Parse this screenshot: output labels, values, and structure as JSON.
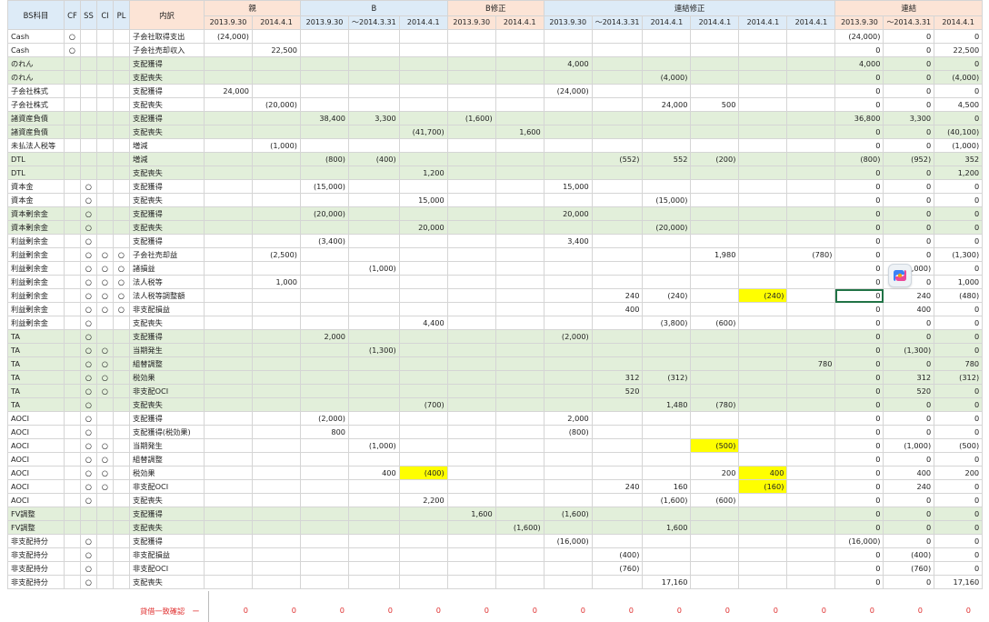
{
  "header": {
    "top": {
      "bs": "BS科目",
      "cf": "CF",
      "ss": "SS",
      "ci": "CI",
      "pl": "PL",
      "desc": "内訳",
      "g1": "親",
      "g2": "B",
      "g3": "B修正",
      "g4": "連結修正",
      "g5": "連結"
    },
    "sub": [
      "2013.9.30",
      "2014.4.1",
      "2013.9.30",
      "～2014.3.31",
      "2014.4.1",
      "2013.9.30",
      "2014.4.1",
      "2013.9.30",
      "～2014.3.31",
      "2014.4.1",
      "2014.4.1",
      "2014.4.1",
      "2014.4.1",
      "2013.9.30",
      "～2014.3.31",
      "2014.4.1"
    ]
  },
  "rows": [
    {
      "bs": "Cash",
      "cf": "○",
      "ss": "",
      "ci": "",
      "pl": "",
      "desc": "子会社取得支出",
      "v": [
        "(24,000)",
        "",
        "",
        "",
        "",
        "",
        "",
        "",
        "",
        "",
        "",
        "",
        "",
        "(24,000)",
        "0",
        "0"
      ]
    },
    {
      "bs": "Cash",
      "cf": "○",
      "ss": "",
      "ci": "",
      "pl": "",
      "desc": "子会社売却収入",
      "v": [
        "",
        "22,500",
        "",
        "",
        "",
        "",
        "",
        "",
        "",
        "",
        "",
        "",
        "",
        "0",
        "0",
        "22,500"
      ]
    },
    {
      "bs": "のれん",
      "cf": "",
      "ss": "",
      "ci": "",
      "pl": "",
      "desc": "支配獲得",
      "v": [
        "",
        "",
        "",
        "",
        "",
        "",
        "",
        "4,000",
        "",
        "",
        "",
        "",
        "",
        "4,000",
        "0",
        "0"
      ]
    },
    {
      "bs": "のれん",
      "cf": "",
      "ss": "",
      "ci": "",
      "pl": "",
      "desc": "支配喪失",
      "v": [
        "",
        "",
        "",
        "",
        "",
        "",
        "",
        "",
        "",
        "(4,000)",
        "",
        "",
        "",
        "0",
        "0",
        "(4,000)"
      ]
    },
    {
      "bs": "子会社株式",
      "cf": "",
      "ss": "",
      "ci": "",
      "pl": "",
      "desc": "支配獲得",
      "v": [
        "24,000",
        "",
        "",
        "",
        "",
        "",
        "",
        "(24,000)",
        "",
        "",
        "",
        "",
        "",
        "0",
        "0",
        "0"
      ]
    },
    {
      "bs": "子会社株式",
      "cf": "",
      "ss": "",
      "ci": "",
      "pl": "",
      "desc": "支配喪失",
      "v": [
        "",
        "(20,000)",
        "",
        "",
        "",
        "",
        "",
        "",
        "",
        "24,000",
        "500",
        "",
        "",
        "0",
        "0",
        "4,500"
      ]
    },
    {
      "bs": "諸資産負債",
      "cf": "",
      "ss": "",
      "ci": "",
      "pl": "",
      "desc": "支配獲得",
      "v": [
        "",
        "",
        "38,400",
        "3,300",
        "",
        "(1,600)",
        "",
        "",
        "",
        "",
        "",
        "",
        "",
        "36,800",
        "3,300",
        "0"
      ]
    },
    {
      "bs": "諸資産負債",
      "cf": "",
      "ss": "",
      "ci": "",
      "pl": "",
      "desc": "支配喪失",
      "v": [
        "",
        "",
        "",
        "",
        "(41,700)",
        "",
        "1,600",
        "",
        "",
        "",
        "",
        "",
        "",
        "0",
        "0",
        "(40,100)"
      ]
    },
    {
      "bs": "未払法人税等",
      "cf": "",
      "ss": "",
      "ci": "",
      "pl": "",
      "desc": "増減",
      "v": [
        "",
        "(1,000)",
        "",
        "",
        "",
        "",
        "",
        "",
        "",
        "",
        "",
        "",
        "",
        "0",
        "0",
        "(1,000)"
      ]
    },
    {
      "bs": "DTL",
      "cf": "",
      "ss": "",
      "ci": "",
      "pl": "",
      "desc": "増減",
      "v": [
        "",
        "",
        "(800)",
        "(400)",
        "",
        "",
        "",
        "",
        "(552)",
        "552",
        "(200)",
        "",
        "",
        "(800)",
        "(952)",
        "352"
      ]
    },
    {
      "bs": "DTL",
      "cf": "",
      "ss": "",
      "ci": "",
      "pl": "",
      "desc": "支配喪失",
      "v": [
        "",
        "",
        "",
        "",
        "1,200",
        "",
        "",
        "",
        "",
        "",
        "",
        "",
        "",
        "0",
        "0",
        "1,200"
      ]
    },
    {
      "bs": "資本金",
      "cf": "",
      "ss": "○",
      "ci": "",
      "pl": "",
      "desc": "支配獲得",
      "v": [
        "",
        "",
        "(15,000)",
        "",
        "",
        "",
        "",
        "15,000",
        "",
        "",
        "",
        "",
        "",
        "0",
        "0",
        "0"
      ]
    },
    {
      "bs": "資本金",
      "cf": "",
      "ss": "○",
      "ci": "",
      "pl": "",
      "desc": "支配喪失",
      "v": [
        "",
        "",
        "",
        "",
        "15,000",
        "",
        "",
        "",
        "",
        "(15,000)",
        "",
        "",
        "",
        "0",
        "0",
        "0"
      ]
    },
    {
      "bs": "資本剰余金",
      "cf": "",
      "ss": "○",
      "ci": "",
      "pl": "",
      "desc": "支配獲得",
      "v": [
        "",
        "",
        "(20,000)",
        "",
        "",
        "",
        "",
        "20,000",
        "",
        "",
        "",
        "",
        "",
        "0",
        "0",
        "0"
      ]
    },
    {
      "bs": "資本剰余金",
      "cf": "",
      "ss": "○",
      "ci": "",
      "pl": "",
      "desc": "支配喪失",
      "v": [
        "",
        "",
        "",
        "",
        "20,000",
        "",
        "",
        "",
        "",
        "(20,000)",
        "",
        "",
        "",
        "0",
        "0",
        "0"
      ]
    },
    {
      "bs": "利益剰余金",
      "cf": "",
      "ss": "○",
      "ci": "",
      "pl": "",
      "desc": "支配獲得",
      "v": [
        "",
        "",
        "(3,400)",
        "",
        "",
        "",
        "",
        "3,400",
        "",
        "",
        "",
        "",
        "",
        "0",
        "0",
        "0"
      ]
    },
    {
      "bs": "利益剰余金",
      "cf": "",
      "ss": "○",
      "ci": "○",
      "pl": "○",
      "desc": "子会社売却益",
      "v": [
        "",
        "(2,500)",
        "",
        "",
        "",
        "",
        "",
        "",
        "",
        "",
        "1,980",
        "",
        "(780)",
        "0",
        "0",
        "(1,300)"
      ]
    },
    {
      "bs": "利益剰余金",
      "cf": "",
      "ss": "○",
      "ci": "○",
      "pl": "○",
      "desc": "諸損益",
      "v": [
        "",
        "",
        "",
        "(1,000)",
        "",
        "",
        "",
        "",
        "",
        "",
        "",
        "",
        "",
        "0",
        "(1,000)",
        "0"
      ]
    },
    {
      "bs": "利益剰余金",
      "cf": "",
      "ss": "○",
      "ci": "○",
      "pl": "○",
      "desc": "法人税等",
      "v": [
        "",
        "1,000",
        "",
        "",
        "",
        "",
        "",
        "",
        "",
        "",
        "",
        "",
        "",
        "0",
        "0",
        "1,000"
      ]
    },
    {
      "bs": "利益剰余金",
      "cf": "",
      "ss": "○",
      "ci": "○",
      "pl": "○",
      "desc": "法人税等調整額",
      "v": [
        "",
        "",
        "",
        "",
        "",
        "",
        "",
        "",
        "240",
        "(240)",
        "",
        "(240)",
        "",
        "0",
        "240",
        "(480)"
      ]
    },
    {
      "bs": "利益剰余金",
      "cf": "",
      "ss": "○",
      "ci": "○",
      "pl": "○",
      "desc": "非支配損益",
      "v": [
        "",
        "",
        "",
        "",
        "",
        "",
        "",
        "",
        "400",
        "",
        "",
        "",
        "",
        "0",
        "400",
        "0"
      ]
    },
    {
      "bs": "利益剰余金",
      "cf": "",
      "ss": "○",
      "ci": "",
      "pl": "",
      "desc": "支配喪失",
      "v": [
        "",
        "",
        "",
        "",
        "4,400",
        "",
        "",
        "",
        "",
        "(3,800)",
        "(600)",
        "",
        "",
        "0",
        "0",
        "0"
      ]
    },
    {
      "bs": "TA",
      "cf": "",
      "ss": "○",
      "ci": "",
      "pl": "",
      "desc": "支配獲得",
      "v": [
        "",
        "",
        "2,000",
        "",
        "",
        "",
        "",
        "(2,000)",
        "",
        "",
        "",
        "",
        "",
        "0",
        "0",
        "0"
      ]
    },
    {
      "bs": "TA",
      "cf": "",
      "ss": "○",
      "ci": "○",
      "pl": "",
      "desc": "当期発生",
      "v": [
        "",
        "",
        "",
        "(1,300)",
        "",
        "",
        "",
        "",
        "",
        "",
        "",
        "",
        "",
        "0",
        "(1,300)",
        "0"
      ]
    },
    {
      "bs": "TA",
      "cf": "",
      "ss": "○",
      "ci": "○",
      "pl": "",
      "desc": "組替調整",
      "v": [
        "",
        "",
        "",
        "",
        "",
        "",
        "",
        "",
        "",
        "",
        "",
        "",
        "780",
        "0",
        "0",
        "780"
      ]
    },
    {
      "bs": "TA",
      "cf": "",
      "ss": "○",
      "ci": "○",
      "pl": "",
      "desc": "税効果",
      "v": [
        "",
        "",
        "",
        "",
        "",
        "",
        "",
        "",
        "312",
        "(312)",
        "",
        "",
        "",
        "0",
        "312",
        "(312)"
      ]
    },
    {
      "bs": "TA",
      "cf": "",
      "ss": "○",
      "ci": "○",
      "pl": "",
      "desc": "非支配OCI",
      "v": [
        "",
        "",
        "",
        "",
        "",
        "",
        "",
        "",
        "520",
        "",
        "",
        "",
        "",
        "0",
        "520",
        "0"
      ]
    },
    {
      "bs": "TA",
      "cf": "",
      "ss": "○",
      "ci": "",
      "pl": "",
      "desc": "支配喪失",
      "v": [
        "",
        "",
        "",
        "",
        "(700)",
        "",
        "",
        "",
        "",
        "1,480",
        "(780)",
        "",
        "",
        "0",
        "0",
        "0"
      ]
    },
    {
      "bs": "AOCI",
      "cf": "",
      "ss": "○",
      "ci": "",
      "pl": "",
      "desc": "支配獲得",
      "v": [
        "",
        "",
        "(2,000)",
        "",
        "",
        "",
        "",
        "2,000",
        "",
        "",
        "",
        "",
        "",
        "0",
        "0",
        "0"
      ]
    },
    {
      "bs": "AOCI",
      "cf": "",
      "ss": "○",
      "ci": "",
      "pl": "",
      "desc": "支配獲得(税効果)",
      "v": [
        "",
        "",
        "800",
        "",
        "",
        "",
        "",
        "(800)",
        "",
        "",
        "",
        "",
        "",
        "0",
        "0",
        "0"
      ]
    },
    {
      "bs": "AOCI",
      "cf": "",
      "ss": "○",
      "ci": "○",
      "pl": "",
      "desc": "当期発生",
      "v": [
        "",
        "",
        "",
        "(1,000)",
        "",
        "",
        "",
        "",
        "",
        "",
        "(500)",
        "",
        "",
        "0",
        "(1,000)",
        "(500)"
      ]
    },
    {
      "bs": "AOCI",
      "cf": "",
      "ss": "○",
      "ci": "○",
      "pl": "",
      "desc": "組替調整",
      "v": [
        "",
        "",
        "",
        "",
        "",
        "",
        "",
        "",
        "",
        "",
        "",
        "",
        "",
        "0",
        "0",
        "0"
      ]
    },
    {
      "bs": "AOCI",
      "cf": "",
      "ss": "○",
      "ci": "○",
      "pl": "",
      "desc": "税効果",
      "v": [
        "",
        "",
        "",
        "400",
        "(400)",
        "",
        "",
        "",
        "",
        "",
        "200",
        "400",
        "",
        "0",
        "400",
        "200"
      ]
    },
    {
      "bs": "AOCI",
      "cf": "",
      "ss": "○",
      "ci": "○",
      "pl": "",
      "desc": "非支配OCI",
      "v": [
        "",
        "",
        "",
        "",
        "",
        "",
        "",
        "",
        "240",
        "160",
        "",
        "(160)",
        "",
        "0",
        "240",
        "0"
      ]
    },
    {
      "bs": "AOCI",
      "cf": "",
      "ss": "○",
      "ci": "",
      "pl": "",
      "desc": "支配喪失",
      "v": [
        "",
        "",
        "",
        "",
        "2,200",
        "",
        "",
        "",
        "",
        "(1,600)",
        "(600)",
        "",
        "",
        "0",
        "0",
        "0"
      ]
    },
    {
      "bs": "FV調整",
      "cf": "",
      "ss": "",
      "ci": "",
      "pl": "",
      "desc": "支配獲得",
      "v": [
        "",
        "",
        "",
        "",
        "",
        "1,600",
        "",
        "(1,600)",
        "",
        "",
        "",
        "",
        "",
        "0",
        "0",
        "0"
      ]
    },
    {
      "bs": "FV調整",
      "cf": "",
      "ss": "",
      "ci": "",
      "pl": "",
      "desc": "支配喪失",
      "v": [
        "",
        "",
        "",
        "",
        "",
        "",
        "(1,600)",
        "",
        "",
        "1,600",
        "",
        "",
        "",
        "0",
        "0",
        "0"
      ]
    },
    {
      "bs": "非支配持分",
      "cf": "",
      "ss": "○",
      "ci": "",
      "pl": "",
      "desc": "支配獲得",
      "v": [
        "",
        "",
        "",
        "",
        "",
        "",
        "",
        "(16,000)",
        "",
        "",
        "",
        "",
        "",
        "(16,000)",
        "0",
        "0"
      ]
    },
    {
      "bs": "非支配持分",
      "cf": "",
      "ss": "○",
      "ci": "",
      "pl": "",
      "desc": "非支配損益",
      "v": [
        "",
        "",
        "",
        "",
        "",
        "",
        "",
        "",
        "(400)",
        "",
        "",
        "",
        "",
        "0",
        "(400)",
        "0"
      ]
    },
    {
      "bs": "非支配持分",
      "cf": "",
      "ss": "○",
      "ci": "",
      "pl": "",
      "desc": "非支配OCI",
      "v": [
        "",
        "",
        "",
        "",
        "",
        "",
        "",
        "",
        "(760)",
        "",
        "",
        "",
        "",
        "0",
        "(760)",
        "0"
      ]
    },
    {
      "bs": "非支配持分",
      "cf": "",
      "ss": "○",
      "ci": "",
      "pl": "",
      "desc": "支配喪失",
      "v": [
        "",
        "",
        "",
        "",
        "",
        "",
        "",
        "",
        "",
        "17,160",
        "",
        "",
        "",
        "0",
        "0",
        "17,160"
      ]
    }
  ],
  "footer": {
    "label": "貸借一致確認　ー",
    "values": [
      "0",
      "0",
      "0",
      "0",
      "0",
      "0",
      "0",
      "0",
      "0",
      "0",
      "0",
      "0",
      "0",
      "0",
      "0",
      "0"
    ]
  },
  "colors": {
    "header_blue": "#ddebf7",
    "header_peach": "#fce4d6",
    "row_green": "#e2efda",
    "highlight": "#ffff00",
    "selection": "#217346",
    "footer_text": "#e03030"
  },
  "icons": {
    "copilot": "copilot-icon"
  }
}
